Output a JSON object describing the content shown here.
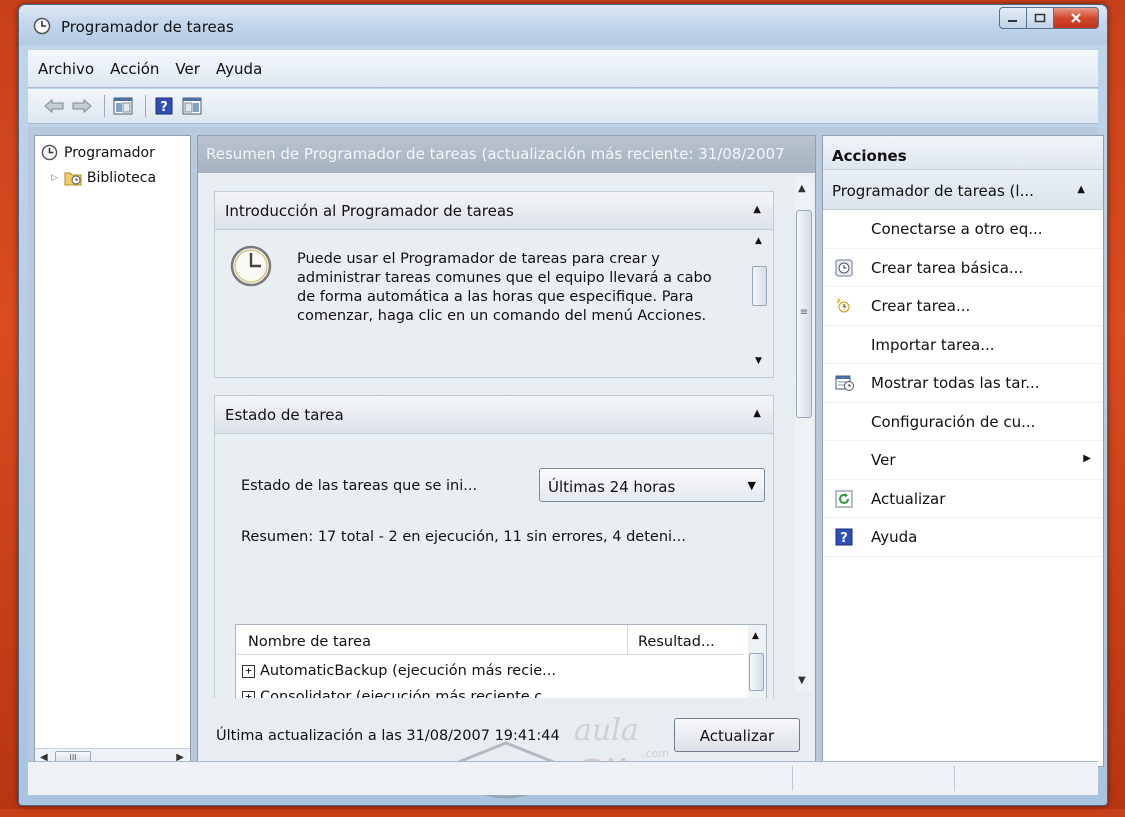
{
  "window": {
    "title": "Programador de tareas"
  },
  "menu": [
    "Archivo",
    "Acción",
    "Ver",
    "Ayuda"
  ],
  "tree": {
    "root": "Programador",
    "library": "Biblioteca",
    "scroll_label": "III"
  },
  "center": {
    "header": "Resumen de Programador de tareas (actualización más reciente: 31/08/2007",
    "intro": {
      "title": "Introducción al Programador de tareas",
      "text": "Puede usar el Programador de tareas para crear y administrar tareas comunes que el equipo llevará a cabo de forma automática a las horas que especifique. Para comenzar, haga clic en un comando del menú Acciones."
    },
    "status": {
      "title": "Estado de tarea",
      "filter_label": "Estado de las tareas que se ini...",
      "filter_value": "Últimas 24 horas",
      "summary": "Resumen: 17 total - 2 en ejecución, 11 sin errores, 4 deteni...",
      "table": {
        "columns": [
          "Nombre de tarea",
          "Resultad..."
        ],
        "rows": [
          "AutomaticBackup (ejecución más recie...",
          "Consolidator (ejecución más reciente c..."
        ]
      }
    },
    "footer": {
      "last_update": "Última actualización a las 31/08/2007 19:41:44",
      "refresh_button": "Actualizar"
    }
  },
  "actions": {
    "title": "Acciones",
    "group": "Programador de tareas (l...",
    "items": [
      {
        "label": "Conectarse a otro eq...",
        "icon": "none"
      },
      {
        "label": "Crear tarea básica...",
        "icon": "wizard-clock-icon"
      },
      {
        "label": "Crear tarea...",
        "icon": "new-task-icon"
      },
      {
        "label": "Importar tarea...",
        "icon": "none"
      },
      {
        "label": "Mostrar todas las tar...",
        "icon": "running-tasks-icon"
      },
      {
        "label": "Configuración de cu...",
        "icon": "none"
      },
      {
        "label": "Ver",
        "icon": "none"
      },
      {
        "label": "Actualizar",
        "icon": "refresh-icon"
      },
      {
        "label": "Ayuda",
        "icon": "help-icon"
      }
    ]
  },
  "watermark": {
    "brand": "aula",
    "brand2": "Clic",
    "suffix": ".com"
  },
  "colors": {
    "desktop": "#d94c1f",
    "window_frame": "#bfd5ea",
    "help_blue": "#2f4fb8"
  }
}
